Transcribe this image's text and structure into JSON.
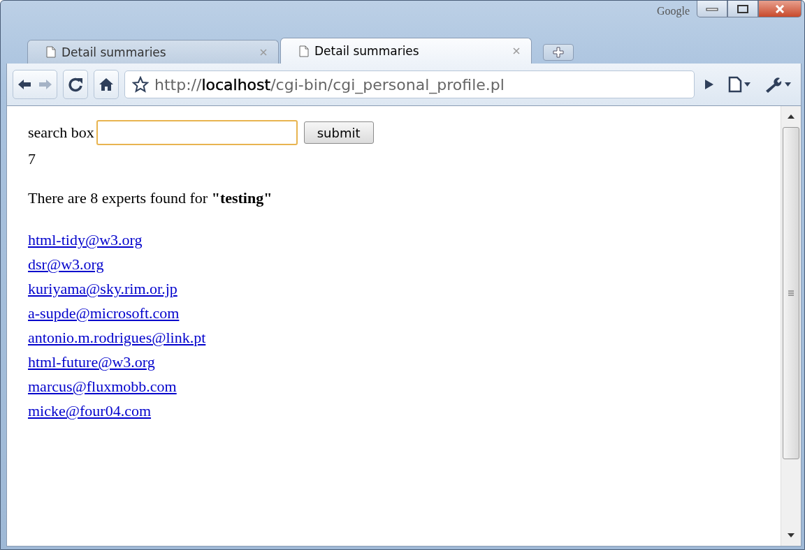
{
  "window": {
    "brand": "Google"
  },
  "tabs": [
    {
      "title": "Detail summaries",
      "selected": false
    },
    {
      "title": "Detail summaries",
      "selected": true
    }
  ],
  "address": {
    "url": "http://**localhost**/cgi-bin/cgi_personal_profile.pl"
  },
  "page": {
    "search_label": "search box",
    "button": "submit",
    "count": "7",
    "summary": "There are 8 experts found for **\"testing\"**",
    "links": [
      "html-tidy@w3.org",
      "dsr@w3.org",
      "kuriyama@sky.rim.or.jp",
      "a-supde@microsoft.com",
      "antonio.m.rodrigues@link.pt",
      "html-future@w3.org",
      "marcus@fluxmobb.com",
      "micke@four04.com"
    ]
  }
}
